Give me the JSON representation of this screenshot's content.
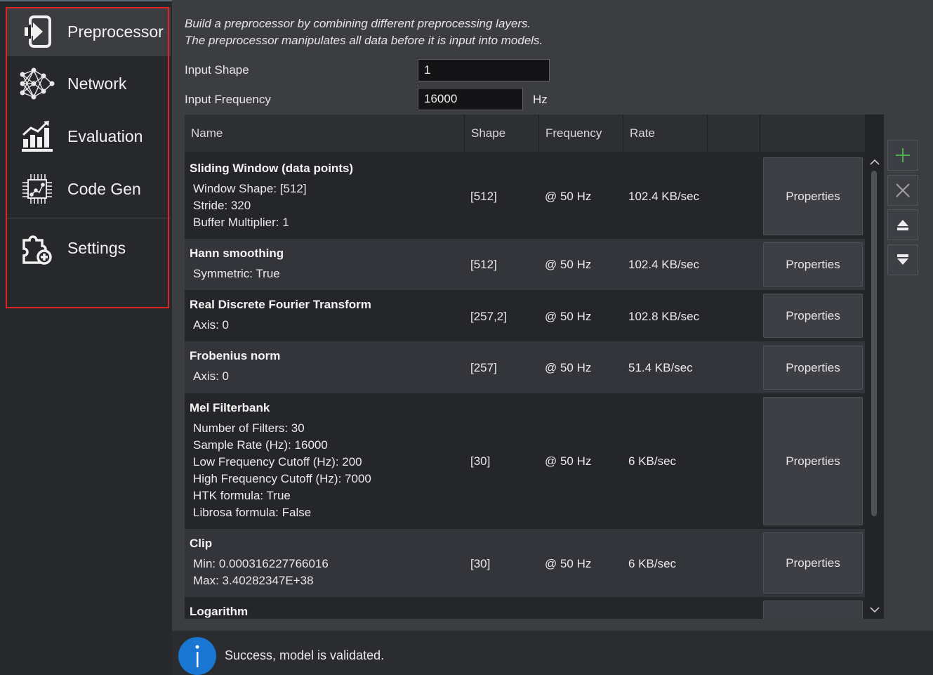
{
  "sidebar": {
    "items": [
      {
        "label": "Preprocessor",
        "icon": "login-icon",
        "active": true
      },
      {
        "label": "Network",
        "icon": "neural-network-icon",
        "active": false
      },
      {
        "label": "Evaluation",
        "icon": "bar-chart-icon",
        "active": false
      },
      {
        "label": "Code Gen",
        "icon": "chip-icon",
        "active": false
      },
      {
        "label": "Settings",
        "icon": "puzzle-add-icon",
        "active": false
      }
    ]
  },
  "description": {
    "line1": "Build a preprocessor by combining different preprocessing layers.",
    "line2": "The preprocessor manipulates all data before it is input into models."
  },
  "input_shape": {
    "label": "Input Shape",
    "value": "1"
  },
  "input_frequency": {
    "label": "Input Frequency",
    "value": "16000",
    "unit": "Hz"
  },
  "table": {
    "headers": {
      "name": "Name",
      "shape": "Shape",
      "frequency": "Frequency",
      "rate": "Rate"
    },
    "properties_label": "Properties",
    "rows": [
      {
        "name": "Sliding Window (data points)",
        "details": [
          "Window Shape: [512]",
          "Stride: 320",
          "Buffer Multiplier: 1"
        ],
        "shape": "[512]",
        "frequency": "@ 50 Hz",
        "rate": "102.4 KB/sec"
      },
      {
        "name": "Hann smoothing",
        "details": [
          "Symmetric: True"
        ],
        "shape": "[512]",
        "frequency": "@ 50 Hz",
        "rate": "102.4 KB/sec"
      },
      {
        "name": "Real Discrete Fourier Transform",
        "details": [
          "Axis: 0"
        ],
        "shape": "[257,2]",
        "frequency": "@ 50 Hz",
        "rate": "102.8 KB/sec"
      },
      {
        "name": "Frobenius norm",
        "details": [
          "Axis: 0"
        ],
        "shape": "[257]",
        "frequency": "@ 50 Hz",
        "rate": "51.4 KB/sec"
      },
      {
        "name": "Mel Filterbank",
        "details": [
          "Number of Filters: 30",
          "Sample Rate (Hz): 16000",
          "Low Frequency Cutoff (Hz): 200",
          "High Frequency Cutoff (Hz): 7000",
          "HTK formula: True",
          "Librosa formula: False"
        ],
        "shape": "[30]",
        "frequency": "@ 50 Hz",
        "rate": "6 KB/sec"
      },
      {
        "name": "Clip",
        "details": [
          "Min: 0.000316227766016",
          "Max: 3.40282347E+38"
        ],
        "shape": "[30]",
        "frequency": "@ 50 Hz",
        "rate": "6 KB/sec"
      },
      {
        "name": "Logarithm",
        "details": [],
        "shape": "",
        "frequency": "",
        "rate": ""
      }
    ]
  },
  "side_buttons": [
    {
      "icon": "plus-icon",
      "color": "#4caf50"
    },
    {
      "icon": "close-icon",
      "color": "#9a9a9a"
    },
    {
      "icon": "move-up-icon",
      "color": "#e8e8e8"
    },
    {
      "icon": "move-down-icon",
      "color": "#e8e8e8"
    }
  ],
  "status": {
    "message": "Success, model is validated.",
    "icon": "info-icon",
    "color": "#1976d2"
  }
}
